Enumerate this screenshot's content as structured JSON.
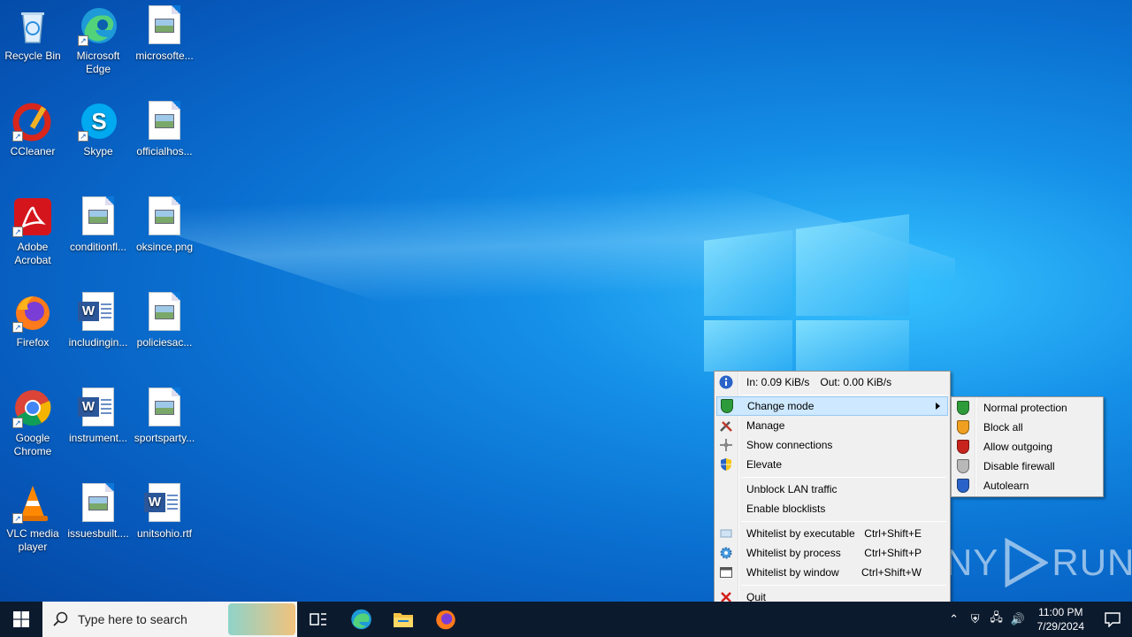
{
  "desktop": {
    "icons": [
      {
        "label": "Recycle Bin"
      },
      {
        "label": "Microsoft Edge"
      },
      {
        "label": "microsofte..."
      },
      {
        "label": "CCleaner"
      },
      {
        "label": "Skype"
      },
      {
        "label": "officialhos..."
      },
      {
        "label": "Adobe Acrobat"
      },
      {
        "label": "conditionfl..."
      },
      {
        "label": "oksince.png"
      },
      {
        "label": "Firefox"
      },
      {
        "label": "includingin..."
      },
      {
        "label": "policiesac..."
      },
      {
        "label": "Google Chrome"
      },
      {
        "label": "instrument..."
      },
      {
        "label": "sportsparty..."
      },
      {
        "label": "VLC media player"
      },
      {
        "label": "issuesbuilt...."
      },
      {
        "label": "unitsohio.rtf"
      }
    ]
  },
  "context_menu": {
    "traffic_in": "In: 0.09 KiB/s",
    "traffic_out": "Out: 0.00 KiB/s",
    "items": [
      {
        "label": "Change mode",
        "icon": "green-shield-icon"
      },
      {
        "label": "Manage",
        "icon": "tools-icon"
      },
      {
        "label": "Show connections",
        "icon": "connections-icon"
      },
      {
        "label": "Elevate",
        "icon": "uac-shield-icon"
      },
      {
        "label": "Unblock LAN traffic"
      },
      {
        "label": "Enable blocklists"
      },
      {
        "label": "Whitelist by executable",
        "shortcut": "Ctrl+Shift+E",
        "icon": "executable-icon"
      },
      {
        "label": "Whitelist by process",
        "shortcut": "Ctrl+Shift+P",
        "icon": "process-gear-icon"
      },
      {
        "label": "Whitelist by window",
        "shortcut": "Ctrl+Shift+W",
        "icon": "window-icon"
      },
      {
        "label": "Quit",
        "icon": "quit-x-icon"
      }
    ]
  },
  "submenu": {
    "items": [
      {
        "label": "Normal protection",
        "color": "#2e9b3a"
      },
      {
        "label": "Block all",
        "color": "#f0a020"
      },
      {
        "label": "Allow outgoing",
        "color": "#c8241e"
      },
      {
        "label": "Disable firewall",
        "color": "#b8b8b8"
      },
      {
        "label": "Autolearn",
        "color": "#2a63c8"
      }
    ]
  },
  "taskbar": {
    "search_placeholder": "Type here to search",
    "time": "11:00 PM",
    "date": "7/29/2024"
  },
  "watermark": {
    "text_left": "ANY",
    "text_right": "RUN"
  }
}
